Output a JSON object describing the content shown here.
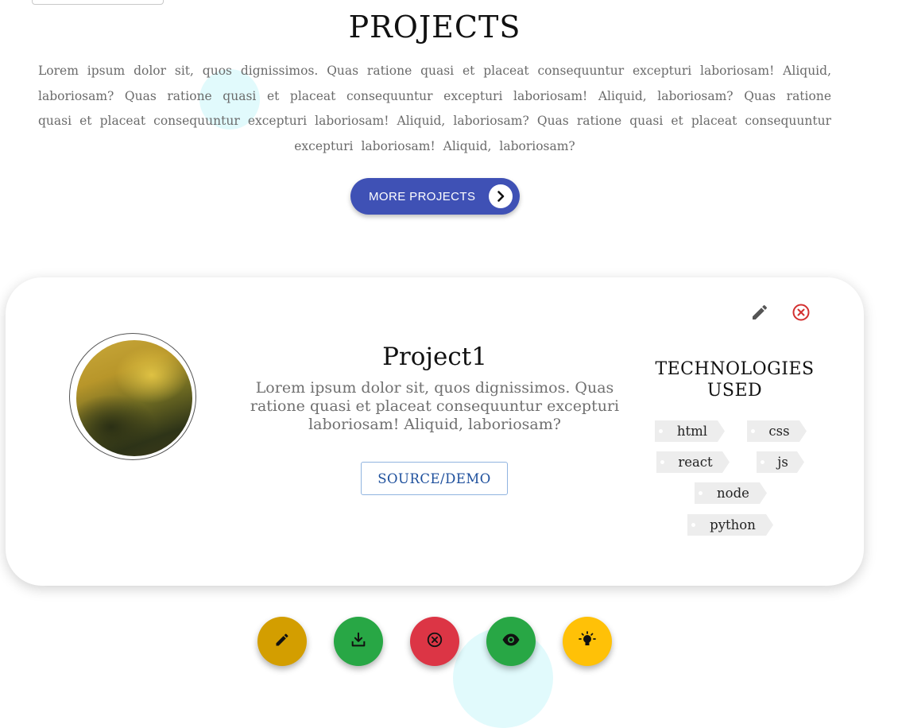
{
  "header": {
    "title": "PROJECTS",
    "intro": "Lorem ipsum dolor sit, quos dignissimos. Quas ratione quasi et placeat consequuntur excepturi laboriosam! Aliquid, laboriosam? Quas ratione quasi et placeat consequuntur excepturi laboriosam! Aliquid, laboriosam? Quas ratione quasi et placeat consequuntur excepturi laboriosam! Aliquid, laboriosam? Quas ratione quasi et placeat consequuntur excepturi laboriosam! Aliquid, laboriosam?",
    "more_button_label": "MORE PROJECTS",
    "more_button_icon": "chevron-right-icon"
  },
  "project_card": {
    "title": "Project1",
    "description": "Lorem ipsum dolor sit, quos dignissimos. Quas ratione quasi et placeat consequuntur excepturi laboriosam! Aliquid, laboriosam?",
    "source_button_label": "SOURCE/DEMO",
    "edit_icon": "pencil-icon",
    "delete_icon": "close-circle-icon",
    "tech_title": "TECHNOLOGIES USED",
    "technologies": [
      "html",
      "css",
      "react",
      "js",
      "node",
      "python"
    ]
  },
  "fab_actions": [
    {
      "name": "edit",
      "icon": "pencil-icon",
      "color": "#d39e00"
    },
    {
      "name": "download",
      "icon": "download-icon",
      "color": "#28a745"
    },
    {
      "name": "delete",
      "icon": "close-circle-icon",
      "color": "#dc3545"
    },
    {
      "name": "view",
      "icon": "eye-icon",
      "color": "#28a745"
    },
    {
      "name": "idea",
      "icon": "lightbulb-icon",
      "color": "#ffc107"
    }
  ],
  "colors": {
    "primary_button": "#3f51b5",
    "source_button_text": "#1d4f9c",
    "delete_red": "#d32f2f",
    "bubble": "#dcf9fb"
  }
}
